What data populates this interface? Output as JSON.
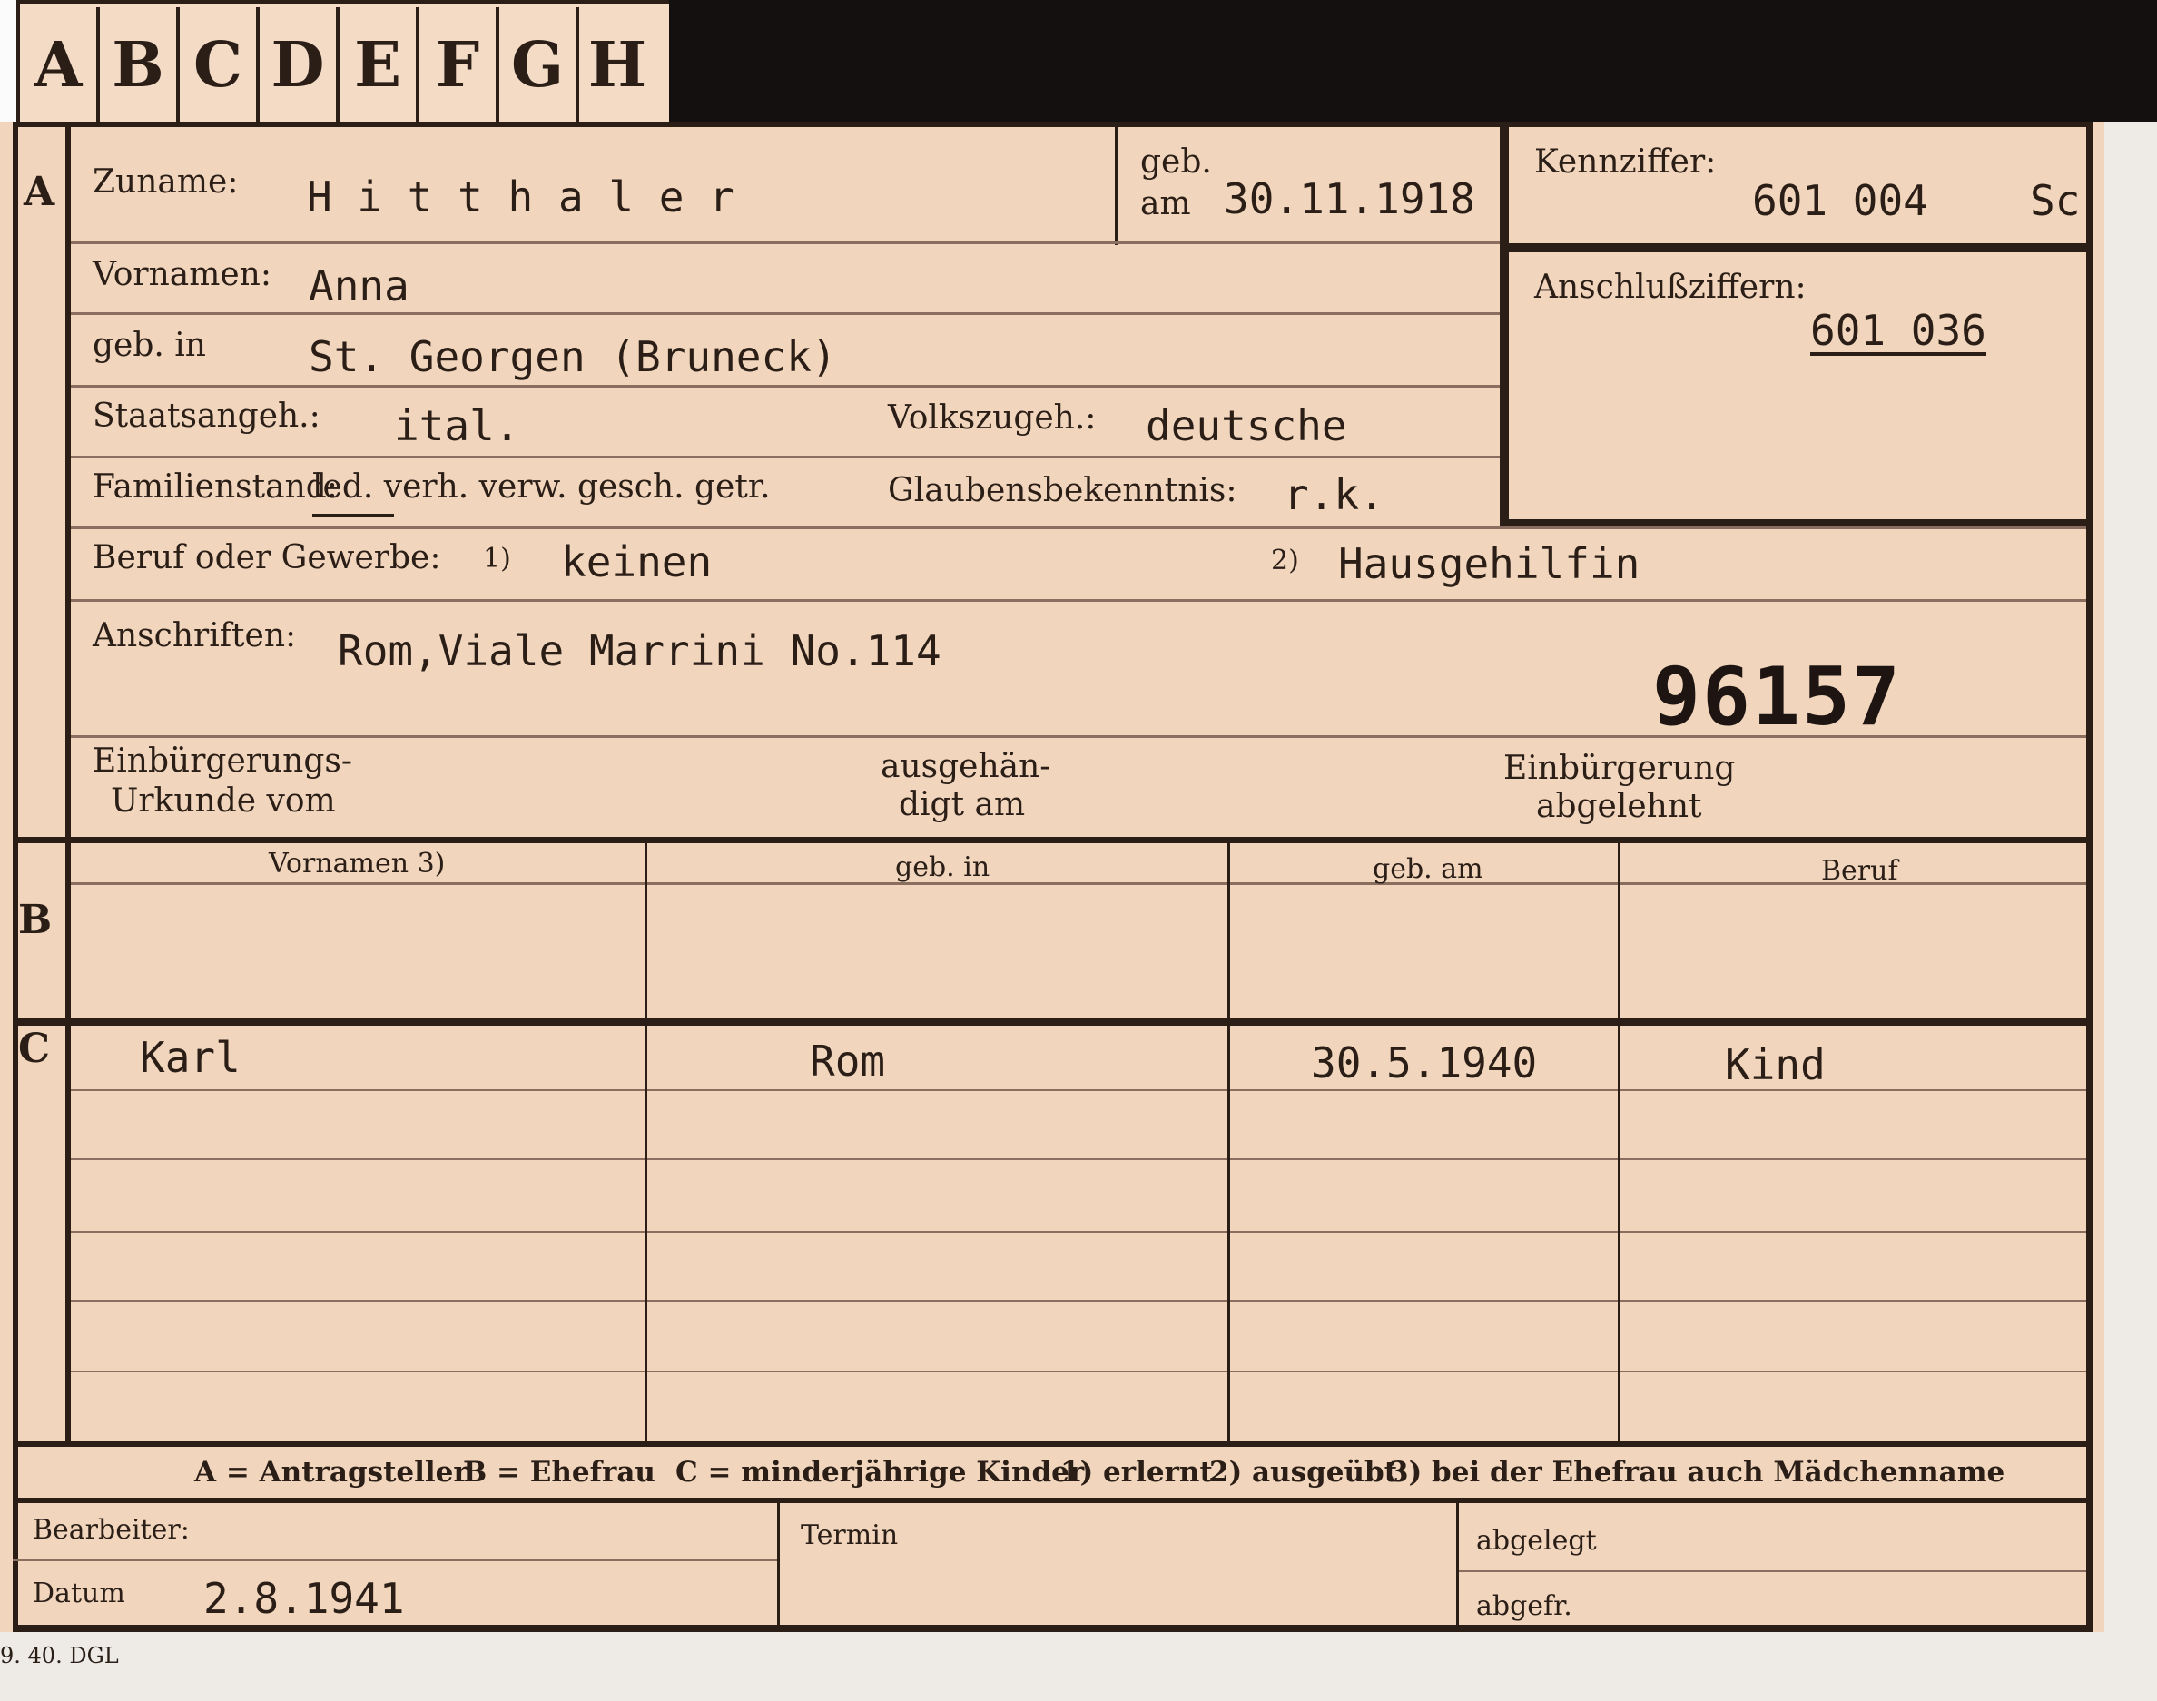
{
  "tabs": [
    "A",
    "B",
    "C",
    "D",
    "E",
    "F",
    "G",
    "H"
  ],
  "sections": {
    "a": "A",
    "b": "B",
    "c": "C"
  },
  "applicant": {
    "surname_label": "Zuname:",
    "surname": "H i t t h a l e r",
    "birth_date_label_1": "geb.",
    "birth_date_label_2": "am",
    "birth_date": "30.11.1918",
    "first_names_label": "Vornamen:",
    "first_names": "Anna",
    "birthplace_label": "geb. in",
    "birthplace": "St. Georgen (Bruneck)",
    "citizenship_label": "Staatsangeh.:",
    "citizenship": "ital.",
    "ethnicity_label": "Volkszugeh.:",
    "ethnicity": "deutsche",
    "marital_label": "Familienstand:",
    "marital_options": "led. verh. verw. gesch. getr.",
    "religion_label": "Glaubensbekenntnis:",
    "religion": "r.k.",
    "occupation_label": "Beruf oder Gewerbe:",
    "occ_mark_1": "1)",
    "occupation_learned": "keinen",
    "occ_mark_2": "2)",
    "occupation_practiced": "Hausgehilfin",
    "address_label": "Anschriften:",
    "address": "Rom,Viale Marrini No.114",
    "stamp_number": "96157",
    "naturalization_label_1": "Einbürgerungs-",
    "naturalization_label_2": "Urkunde vom",
    "handed_label_1": "ausgehän-",
    "handed_label_2": "digt am",
    "rejected_label_1": "Einbürgerung",
    "rejected_label_2": "abgelehnt"
  },
  "ids": {
    "id_label": "Kennziffer:",
    "id_value": "601 004",
    "id_suffix": "Sc",
    "linked_label": "Anschlußziffern:",
    "linked_value": "601 036"
  },
  "table": {
    "headers": [
      "Vornamen 3)",
      "geb. in",
      "geb. am",
      "Beruf"
    ],
    "child_row": {
      "first_name": "Karl",
      "birthplace": "Rom",
      "birth_date": "30.5.1940",
      "occupation": "Kind"
    }
  },
  "legend": {
    "a": "A = Antragsteller",
    "b": "B = Ehefrau",
    "c": "C = minderjährige Kinder",
    "n1": "1) erlernt",
    "n2": "2) ausgeübt",
    "n3": "3) bei der Ehefrau auch Mädchenname"
  },
  "footer": {
    "clerk_label": "Bearbeiter:",
    "date_label": "Datum",
    "date": "2.8.1941",
    "deadline_label": "Termin",
    "filed_label": "abgelegt",
    "abgefr_label": "abgefr.",
    "printer_code": "9. 40. DGL"
  },
  "colors": {
    "paper": "#f1d6bd",
    "ink": "#2a1e17",
    "background": "#ffffff"
  }
}
